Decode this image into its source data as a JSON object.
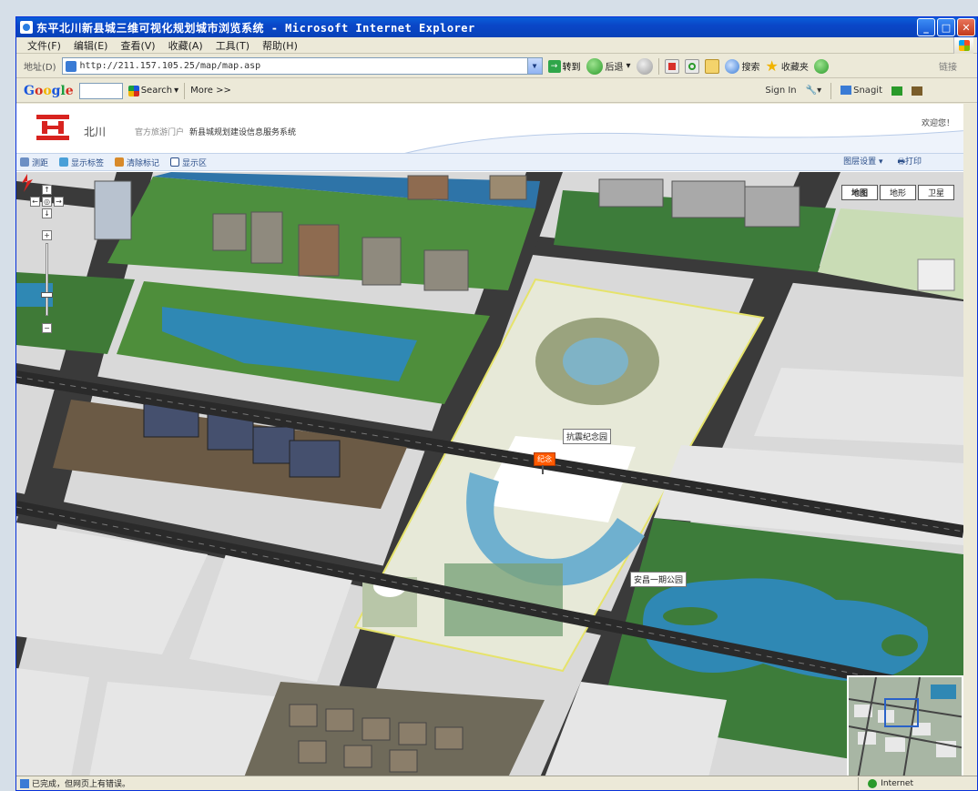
{
  "window": {
    "title": "东平北川新县城三维可视化规划城市浏览系统 - Microsoft Internet Explorer",
    "buttons": {
      "minimize": "_",
      "maximize": "□",
      "close": "✕"
    }
  },
  "menu": [
    "文件(F)",
    "编辑(E)",
    "查看(V)",
    "收藏(A)",
    "工具(T)",
    "帮助(H)"
  ],
  "address": {
    "label": "地址(D)",
    "url": "http://211.157.105.25/map/map.asp",
    "go_label": "转到"
  },
  "toolbar": {
    "back_label": "后退",
    "search_label": "搜索",
    "favorites_label": "收藏夹",
    "links_label": "链接"
  },
  "google_bar": {
    "logo": {
      "G": "G",
      "o1": "o",
      "o2": "o",
      "g": "g",
      "l": "l",
      "e": "e"
    },
    "search_button": "Search",
    "more_label": "More >>",
    "sign_in": "Sign In",
    "snagit": "Snagit"
  },
  "page": {
    "brand": "北川",
    "brand_sub": "官方旅游门户",
    "subtitle": "新县城规划建设信息服务系统",
    "user_link": "欢迎您！",
    "tools": [
      "测距",
      "显示标签",
      "清除标记",
      "显示区"
    ],
    "tools_right": [
      "图层设置",
      "打印"
    ]
  },
  "map": {
    "type_buttons": [
      "地图",
      "地形",
      "卫星"
    ],
    "zoom_buttons": {
      "up": "↑",
      "left": "←",
      "center": "◎",
      "right": "→",
      "down": "↓",
      "plus": "+",
      "minus": "−"
    },
    "labels": {
      "plaza": "抗震纪念园",
      "flag": "纪念",
      "park": "安昌一期公园"
    }
  },
  "status": {
    "text": "已完成，但网页上有错误。",
    "zone": "Internet"
  },
  "colors": {
    "water": "#2f88b4",
    "block": "#e6e6e6",
    "road": "#3a3a3a",
    "green": "#3f7a37",
    "highlight": "#f2f2c2"
  }
}
